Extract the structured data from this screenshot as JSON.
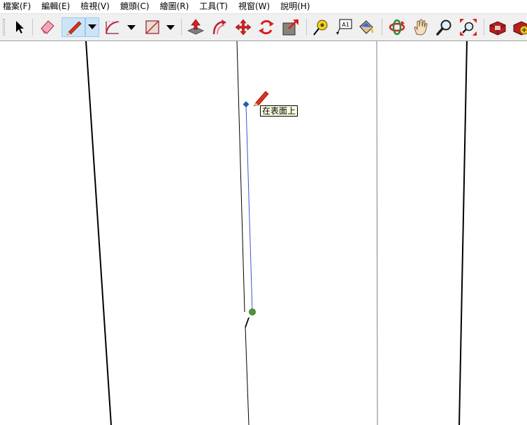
{
  "menu": {
    "items": [
      {
        "label": "檔案(F)"
      },
      {
        "label": "編輯(E)"
      },
      {
        "label": "檢視(V)"
      },
      {
        "label": "鏡頭(C)"
      },
      {
        "label": "繪圖(R)"
      },
      {
        "label": "工具(T)"
      },
      {
        "label": "視窗(W)"
      },
      {
        "label": "說明(H)"
      }
    ]
  },
  "toolbar": {
    "tools": [
      {
        "icon": "select-arrow-icon"
      },
      {
        "icon": "eraser-icon"
      },
      {
        "icon": "pencil-icon",
        "active": true
      },
      {
        "icon": "arc-icon"
      },
      {
        "icon": "rectangle-icon"
      },
      {
        "icon": "push-pull-icon"
      },
      {
        "icon": "follow-me-icon"
      },
      {
        "icon": "move-icon"
      },
      {
        "icon": "rotate-icon"
      },
      {
        "icon": "scale-icon"
      },
      {
        "icon": "tape-measure-icon"
      },
      {
        "icon": "text-label-icon",
        "text": "A1"
      },
      {
        "icon": "paint-bucket-icon"
      },
      {
        "icon": "orbit-icon"
      },
      {
        "icon": "pan-hand-icon"
      },
      {
        "icon": "zoom-icon"
      },
      {
        "icon": "zoom-extents-icon"
      },
      {
        "icon": "warehouse-icon"
      },
      {
        "icon": "extension-warehouse-icon"
      }
    ]
  },
  "viewport": {
    "tooltip": "在表面上",
    "colors": {
      "inference_line": "#3f4fd8",
      "endpoint": "#4b9a3a",
      "start_point": "#1f5fae",
      "edges": "#000000"
    }
  }
}
